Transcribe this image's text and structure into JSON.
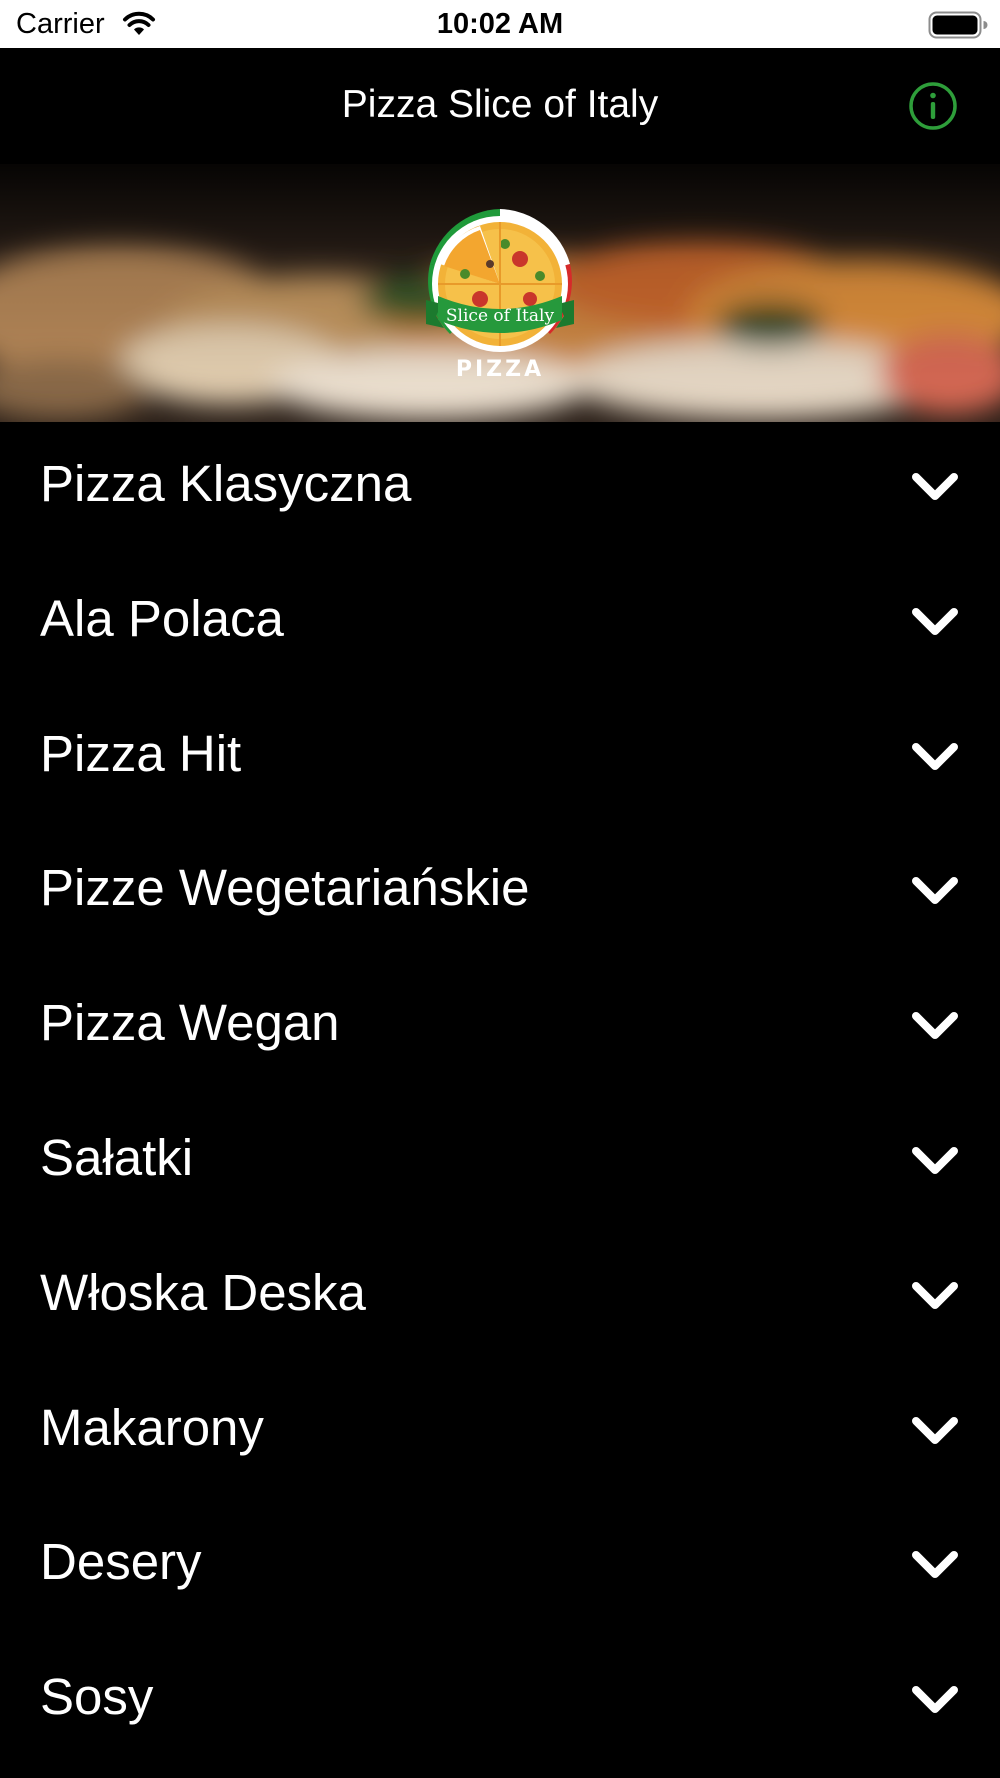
{
  "status_bar": {
    "carrier": "Carrier",
    "time": "10:02 AM",
    "icons": [
      "wifi-icon",
      "battery-icon"
    ]
  },
  "nav": {
    "title": "Pizza Slice of Italy",
    "info_icon": "info-circle-icon",
    "accent_color": "#2e9e3a"
  },
  "hero": {
    "logo": {
      "banner_text": "Slice of Italy",
      "word": "PIZZA"
    }
  },
  "menu": {
    "items": [
      {
        "label": "Pizza Klasyczna",
        "icon": "chevron-down-icon"
      },
      {
        "label": "Ala Polaca",
        "icon": "chevron-down-icon"
      },
      {
        "label": "Pizza Hit",
        "icon": "chevron-down-icon"
      },
      {
        "label": "Pizze Wegetariańskie",
        "icon": "chevron-down-icon"
      },
      {
        "label": "Pizza Wegan",
        "icon": "chevron-down-icon"
      },
      {
        "label": "Sałatki",
        "icon": "chevron-down-icon"
      },
      {
        "label": "Włoska Deska",
        "icon": "chevron-down-icon"
      },
      {
        "label": "Makarony",
        "icon": "chevron-down-icon"
      },
      {
        "label": "Desery",
        "icon": "chevron-down-icon"
      },
      {
        "label": "Sosy",
        "icon": "chevron-down-icon"
      }
    ]
  }
}
